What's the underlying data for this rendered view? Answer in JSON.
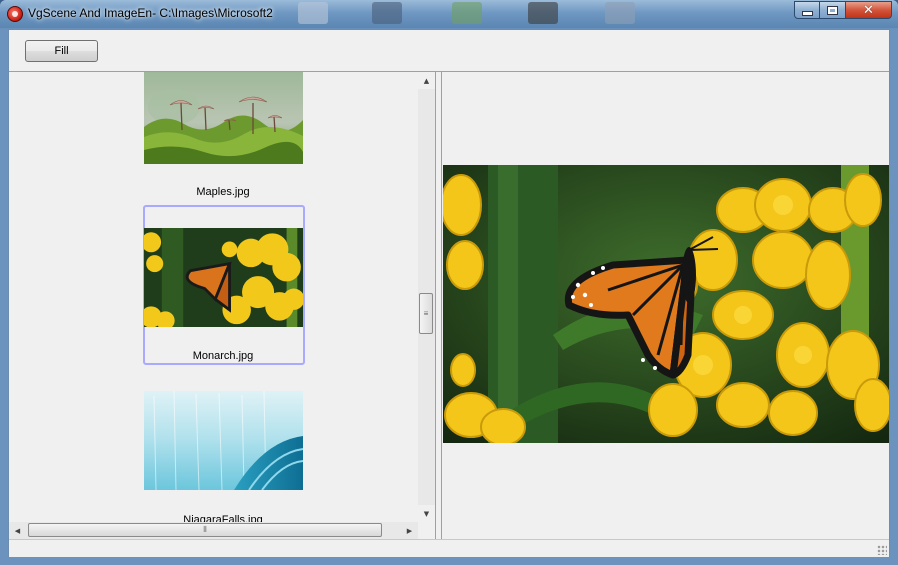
{
  "window": {
    "title": "VgScene And ImageEn- C:\\Images\\Microsoft2",
    "icons": [
      "app-icon",
      "minimize-icon",
      "maximize-icon",
      "close-icon"
    ]
  },
  "toolbar": {
    "fill_label": "Fill"
  },
  "thumbnails": [
    {
      "caption": "Maples.jpg",
      "selected": false
    },
    {
      "caption": "Monarch.jpg",
      "selected": true
    },
    {
      "caption": "NiagaraFalls.jpg",
      "selected": false
    }
  ],
  "scrollbars": {
    "vertical_icons": [
      "scroll-up-icon",
      "scroll-down-icon"
    ],
    "horizontal_icons": [
      "scroll-left-icon",
      "scroll-right-icon"
    ],
    "grip_glyph": "≡",
    "hgrip_glyph": "⦀"
  },
  "colors": {
    "selection_border": "#a9a9ff",
    "title_bar": "#6f98c2",
    "close_button": "#c8442a"
  }
}
